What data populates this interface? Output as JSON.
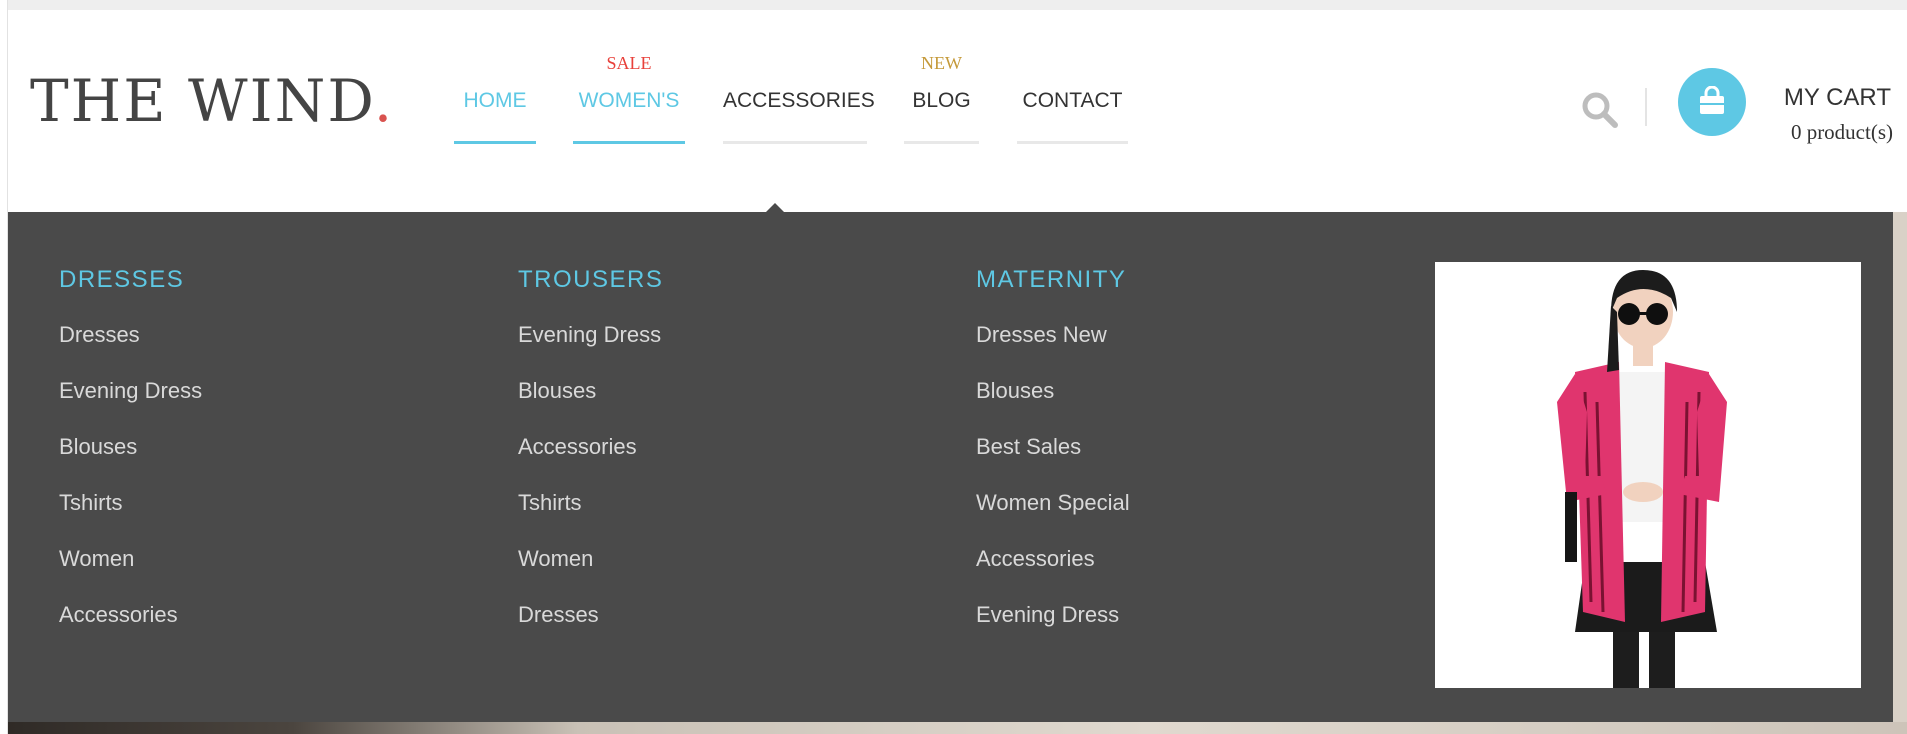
{
  "brand": {
    "logo_text": "THE WIND",
    "logo_dot": "."
  },
  "nav": {
    "items": [
      {
        "label": "HOME",
        "badge": "",
        "active": true
      },
      {
        "label": "WOMEN'S",
        "badge": "SALE",
        "badge_color": "#e8403a",
        "active": true
      },
      {
        "label": "ACCESSORIES",
        "badge": "",
        "active": false
      },
      {
        "label": "BLOG",
        "badge": "NEW",
        "badge_color": "#c59a3a",
        "active": false
      },
      {
        "label": "CONTACT",
        "badge": "",
        "active": false
      }
    ]
  },
  "header_tools": {
    "search_icon": "search-icon",
    "cart_icon": "shopping-bag-icon",
    "cart_title": "MY CART",
    "cart_count": "0 product(s)"
  },
  "mega_menu": {
    "columns": [
      {
        "title": "DRESSES",
        "links": [
          "Dresses",
          "Evening Dress",
          "Blouses",
          "Tshirts",
          "Women",
          "Accessories"
        ]
      },
      {
        "title": "TROUSERS",
        "links": [
          "Evening Dress",
          "Blouses",
          "Accessories",
          "Tshirts",
          "Women",
          "Dresses"
        ]
      },
      {
        "title": "MATERNITY",
        "links": [
          "Dresses New",
          "Blouses",
          "Best Sales",
          "Women Special",
          "Accessories",
          "Evening Dress"
        ]
      }
    ]
  },
  "colors": {
    "accent": "#5ec8e4",
    "menu_bg": "#4a4a4a",
    "menu_link": "#d9d9d9",
    "logo_dot": "#d9534f",
    "product_pink": "#e0356e"
  }
}
